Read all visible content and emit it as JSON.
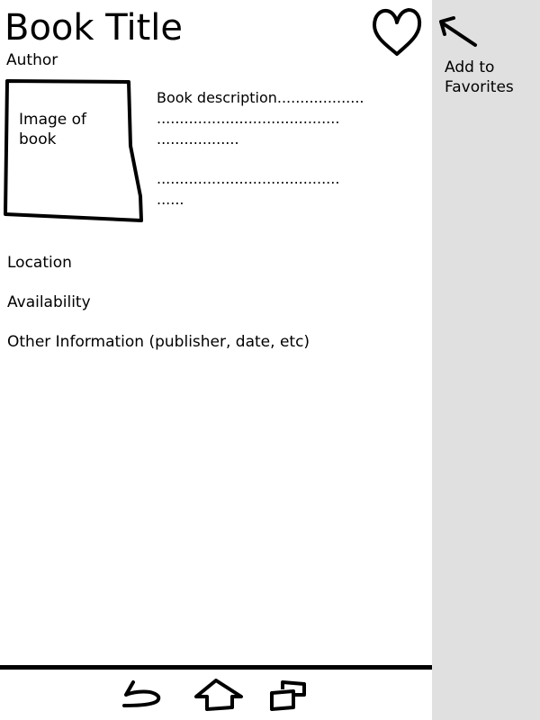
{
  "book": {
    "title": "Book Title",
    "author": "Author",
    "image_label": "Image of book",
    "description_lines": [
      "Book description...................",
      "........................................",
      "..................",
      "........................................",
      "......"
    ]
  },
  "info": {
    "location": "Location",
    "availability": "Availability",
    "other": "Other Information (publisher, date, etc)"
  },
  "sidebar": {
    "favorites_label": "Add to Favorites",
    "background": "#e0e0e0"
  },
  "icons": {
    "favorite": "heart-icon",
    "pointer": "arrow-icon",
    "back": "back-icon",
    "home": "home-icon",
    "windows": "windows-icon"
  }
}
